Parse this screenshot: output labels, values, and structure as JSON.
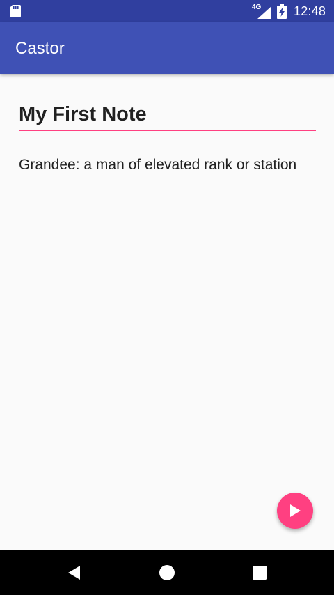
{
  "status_bar": {
    "network_label": "4G",
    "time": "12:48",
    "icons": [
      "sd-card-icon",
      "signal-icon",
      "battery-charging-icon"
    ]
  },
  "app_bar": {
    "title": "Castor"
  },
  "note": {
    "title": "My First Note",
    "body": "Grandee: a man of elevated rank or station"
  },
  "player": {
    "progress": 0.0,
    "play_icon": "play-icon"
  },
  "nav_bar": {
    "icons": [
      "back-icon",
      "home-icon",
      "recents-icon"
    ]
  },
  "colors": {
    "status_bar": "#303f9f",
    "primary": "#3f51b5",
    "accent": "#ff4081",
    "background": "#fafafa",
    "text": "#212121",
    "nav_bar": "#000000"
  }
}
